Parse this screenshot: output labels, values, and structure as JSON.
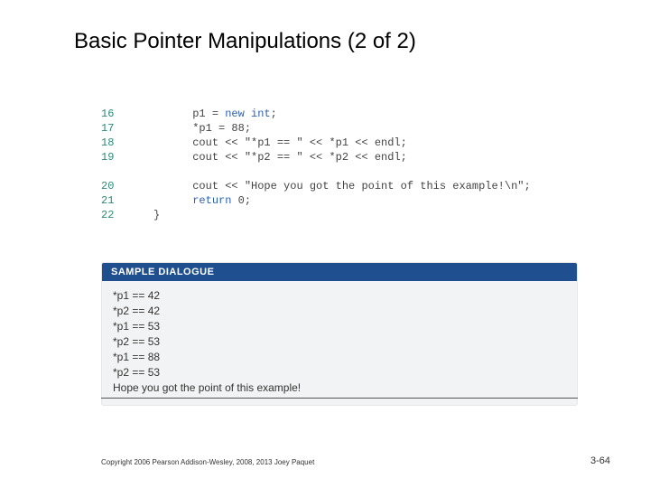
{
  "title": "Basic Pointer Manipulations (2 of 2)",
  "code": {
    "lines": [
      {
        "n": "16",
        "indent": "      ",
        "pre": "p1 = ",
        "kw": "new int",
        "post": ";"
      },
      {
        "n": "17",
        "indent": "      ",
        "pre": "*p1 = 88;",
        "kw": "",
        "post": ""
      },
      {
        "n": "18",
        "indent": "      ",
        "pre": "cout << \"*p1 == \" << *p1 << endl;",
        "kw": "",
        "post": ""
      },
      {
        "n": "19",
        "indent": "      ",
        "pre": "cout << \"*p2 == \" << *p2 << endl;",
        "kw": "",
        "post": ""
      }
    ],
    "lines2": [
      {
        "n": "20",
        "indent": "      ",
        "pre": "cout << \"Hope you got the point of this example!\\n\";",
        "kw": "",
        "post": ""
      },
      {
        "n": "21",
        "indent": "      ",
        "pre": "",
        "kw": "return",
        "post": " 0;"
      },
      {
        "n": "22",
        "indent": "",
        "pre": "}",
        "kw": "",
        "post": ""
      }
    ]
  },
  "dialogue": {
    "header": "SAMPLE DIALOGUE",
    "lines": [
      "*p1 == 42",
      "*p2 == 42",
      "*p1 == 53",
      "*p2 == 53",
      "*p1 == 88",
      "*p2 == 53",
      "Hope you got the point of this example!"
    ]
  },
  "footer": {
    "copyright": "Copyright 2006 Pearson Addison-Wesley, 2008, 2013 Joey Paquet",
    "page": "3-64"
  }
}
